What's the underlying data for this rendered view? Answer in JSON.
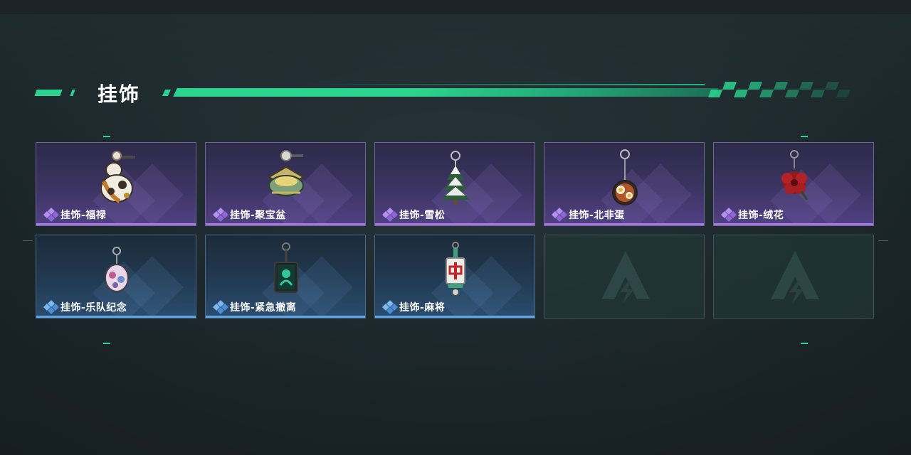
{
  "header": {
    "title": "挂饰"
  },
  "colors": {
    "accent": "#2ad38e",
    "rarity_purple": "#a57be0",
    "rarity_blue": "#5ea5e6"
  },
  "items": [
    {
      "name": "挂饰-福禄",
      "rarity": "purple",
      "icon": "gourd-charm-icon"
    },
    {
      "name": "挂饰-聚宝盆",
      "rarity": "purple",
      "icon": "treasure-bowl-charm-icon"
    },
    {
      "name": "挂饰-雪松",
      "rarity": "purple",
      "icon": "snowy-pine-charm-icon"
    },
    {
      "name": "挂饰-北非蛋",
      "rarity": "purple",
      "icon": "shakshuka-charm-icon"
    },
    {
      "name": "挂饰-绒花",
      "rarity": "purple",
      "icon": "velvet-flower-charm-icon"
    },
    {
      "name": "挂饰-乐队纪念",
      "rarity": "blue",
      "icon": "band-badge-charm-icon"
    },
    {
      "name": "挂饰-紧急撤离",
      "rarity": "blue",
      "icon": "emergency-evac-charm-icon"
    },
    {
      "name": "挂饰-麻将",
      "rarity": "blue",
      "icon": "mahjong-tile-charm-icon"
    }
  ],
  "empty_slots": [
    {
      "icon": "game-logo-icon"
    },
    {
      "icon": "game-logo-icon"
    }
  ]
}
